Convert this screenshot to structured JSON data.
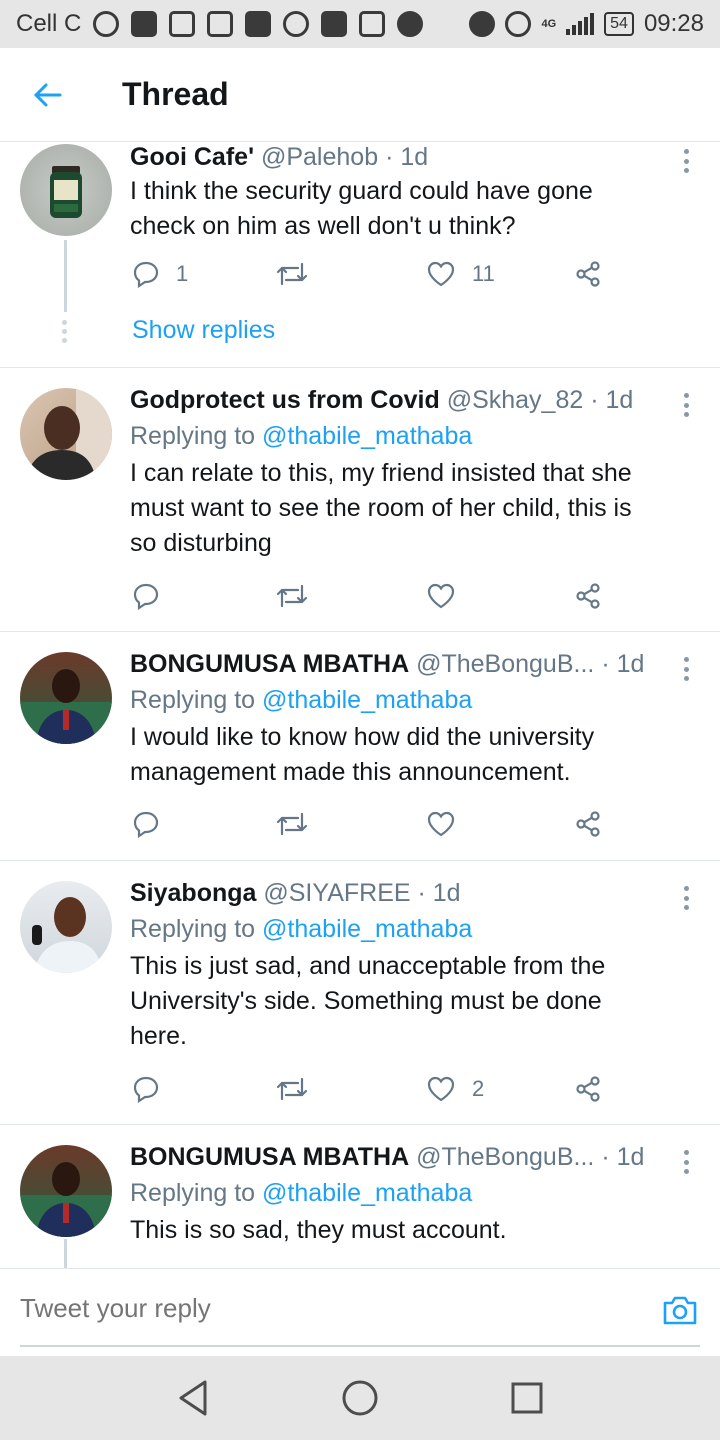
{
  "status_bar": {
    "carrier": "Cell C",
    "network": "4G",
    "battery": "54",
    "time": "09:28"
  },
  "header": {
    "title": "Thread"
  },
  "tweets": [
    {
      "name": "Gooi Cafe'",
      "handle": "@Palehob",
      "separator": "·",
      "time": "1d",
      "replying_prefix": "",
      "replying_to": "",
      "text": "I think the security guard could have gone check on him as well don't u think?",
      "reply_count": "1",
      "retweet_count": "",
      "like_count": "11",
      "show_replies": "Show replies"
    },
    {
      "name": "Godprotect us from Covid",
      "handle": "@Skhay_82",
      "separator": "·",
      "time": "1d",
      "replying_prefix": "Replying to",
      "replying_to": "@thabile_mathaba",
      "text": "I can relate to this, my friend insisted that she must want to see the room of her child, this is so disturbing",
      "reply_count": "",
      "retweet_count": "",
      "like_count": ""
    },
    {
      "name": "BONGUMUSA MBATHA",
      "handle": "@TheBonguB...",
      "separator": "·",
      "time": "1d",
      "replying_prefix": "Replying to",
      "replying_to": "@thabile_mathaba",
      "text": "I would like to know how did the university management made this announcement.",
      "reply_count": "",
      "retweet_count": "",
      "like_count": ""
    },
    {
      "name": "Siyabonga",
      "handle": "@SIYAFREE",
      "separator": "·",
      "time": "1d",
      "replying_prefix": "Replying to",
      "replying_to": "@thabile_mathaba",
      "text": "This is just sad, and unacceptable from the University's side. Something must be done here.",
      "reply_count": "",
      "retweet_count": "",
      "like_count": "2"
    },
    {
      "name": "BONGUMUSA MBATHA",
      "handle": "@TheBonguB...",
      "separator": "·",
      "time": "1d",
      "replying_prefix": "Replying to",
      "replying_to": "@thabile_mathaba",
      "text": "This is so sad, they must account."
    }
  ],
  "reply_bar": {
    "placeholder": "Tweet your reply"
  },
  "colors": {
    "accent": "#1da1f2",
    "muted": "#657786",
    "text": "#14171a",
    "divider": "#e1e8ed"
  },
  "icons": [
    "back-arrow-icon",
    "reply-icon",
    "retweet-icon",
    "like-icon",
    "share-icon",
    "more-icon",
    "camera-icon",
    "nav-back-icon",
    "nav-home-icon",
    "nav-recents-icon"
  ]
}
